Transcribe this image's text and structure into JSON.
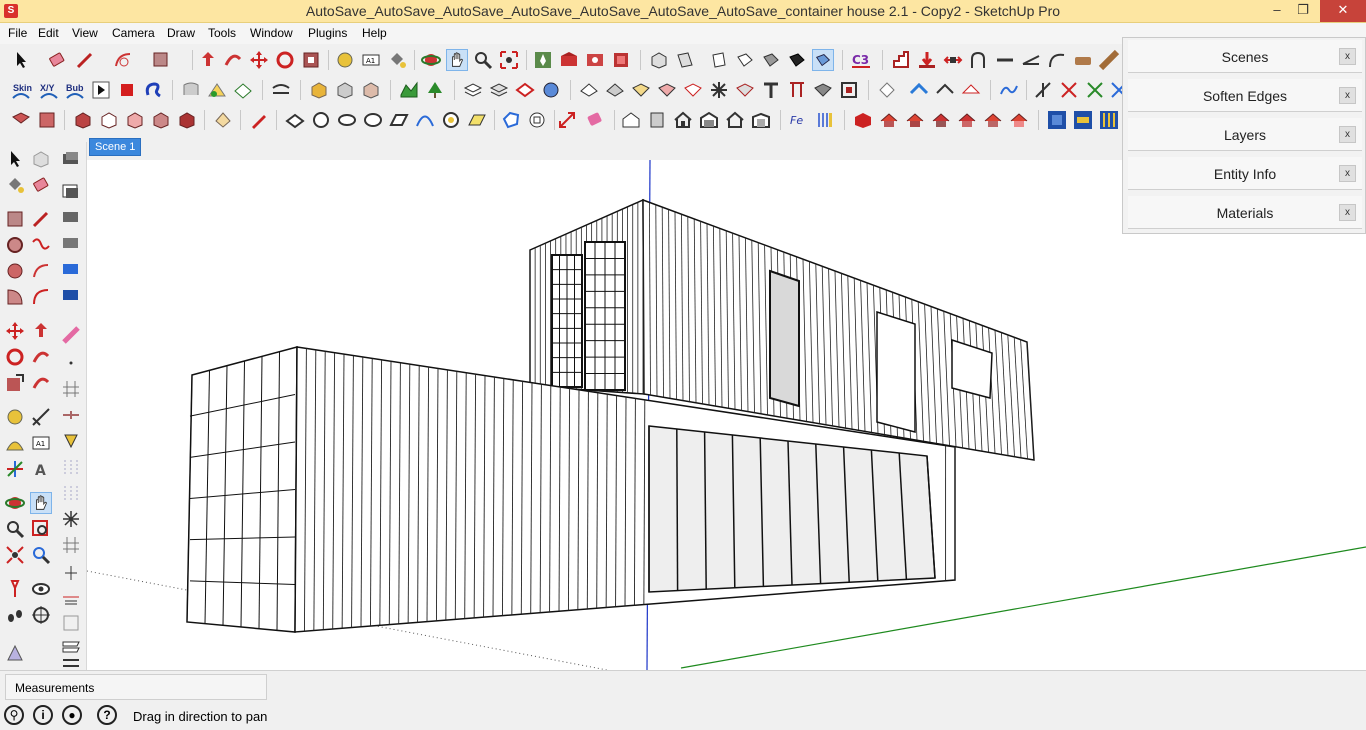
{
  "window": {
    "app_icon": "sketchup-app-icon",
    "title": "AutoSave_AutoSave_AutoSave_AutoSave_AutoSave_AutoSave_AutoSave_container house 2.1 - Copy2 - SketchUp Pro",
    "minimize_icon": "minimize-icon",
    "maximize_icon": "maximize-icon",
    "close_icon": "close-icon",
    "minimize_glyph": "–",
    "maximize_glyph": "❐",
    "close_glyph": "✕"
  },
  "menubar": {
    "items": [
      "File",
      "Edit",
      "View",
      "Camera",
      "Draw",
      "Tools",
      "Window",
      "Plugins",
      "Help"
    ]
  },
  "toolbar": {
    "row2_labels": {
      "skin": "Skin",
      "xy": "X/Y",
      "bub": "Bub"
    },
    "accent_color": "#c9e0f7"
  },
  "scene_tabs": [
    {
      "label": "Scene 1",
      "active": true
    }
  ],
  "tray": {
    "panels": [
      {
        "title": "Scenes",
        "close": "x"
      },
      {
        "title": "Soften Edges",
        "close": "x"
      },
      {
        "title": "Layers",
        "close": "x"
      },
      {
        "title": "Entity Info",
        "close": "x"
      },
      {
        "title": "Materials",
        "close": "x"
      }
    ]
  },
  "statusbar": {
    "measurements_label": "Measurements",
    "measurements_value": "",
    "hint": "Drag in direction to pan",
    "icons": [
      "geo-location-icon",
      "credits-icon",
      "user-icon",
      "help-icon"
    ]
  },
  "viewport": {
    "axis_colors": {
      "blue": "#1a33c8",
      "green": "#1e8a1e",
      "red": "#b01010"
    }
  }
}
